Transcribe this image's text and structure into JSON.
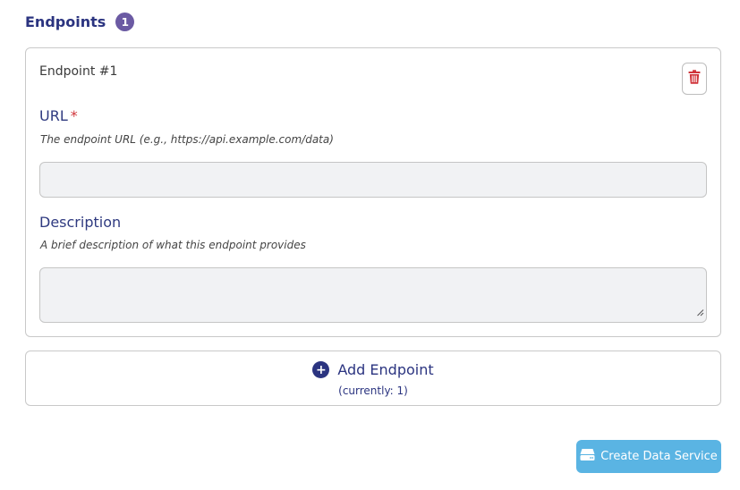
{
  "section": {
    "title": "Endpoints",
    "count": "1"
  },
  "endpoint": {
    "heading": "Endpoint #1",
    "delete_icon": "trash-icon",
    "url": {
      "label": "URL",
      "required_mark": "*",
      "help": "The endpoint URL (e.g., https://api.example.com/data)",
      "value": "",
      "placeholder": ""
    },
    "description": {
      "label": "Description",
      "help": "A brief description of what this endpoint provides",
      "value": "",
      "placeholder": ""
    }
  },
  "add_endpoint": {
    "icon": "plus-circle-icon",
    "label": "Add Endpoint",
    "current": "(currently: 1)"
  },
  "create_button": {
    "icon": "server-icon",
    "label": "Create Data Service"
  },
  "colors": {
    "accent": "#2b3480",
    "badge": "#6b5aa3",
    "danger": "#d0343a",
    "primary_button": "#5ab4e3",
    "input_bg": "#f1f2f4"
  }
}
